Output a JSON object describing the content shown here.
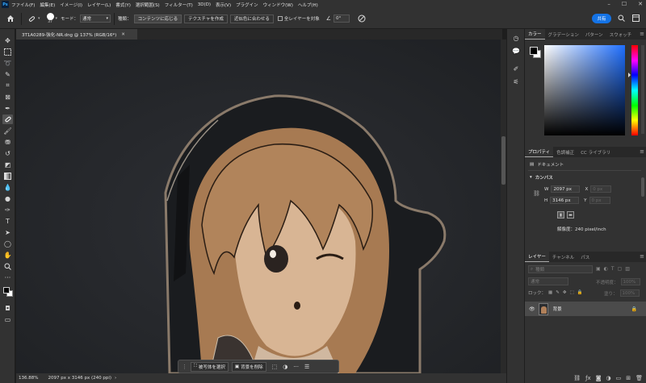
{
  "menu": {
    "logo": "Ps",
    "items": [
      "ファイル(F)",
      "編集(E)",
      "イメージ(I)",
      "レイヤー(L)",
      "書式(Y)",
      "選択範囲(S)",
      "フィルター(T)",
      "3D(D)",
      "表示(V)",
      "プラグイン",
      "ウィンドウ(W)",
      "ヘルプ(H)"
    ]
  },
  "options": {
    "brush_size": "37",
    "mode_label": "モード：",
    "mode_value": "通常",
    "type_label": "種類：",
    "content_aware": "コンテンツに応じる",
    "texture": "テクスチャを作成",
    "proximity": "近似色に合わせる",
    "all_layers": "全レイヤーを対象",
    "angle": "0°",
    "share": "共有"
  },
  "document": {
    "tab_title": "3T1A0289-強化-NR.dng @ 137% (RGB/16*)"
  },
  "taskbar": {
    "select_subject": "被写体を選択",
    "remove_bg": "背景を削除"
  },
  "status": {
    "zoom": "136.88%",
    "size": "2097 px x 3146 px (240 ppi)"
  },
  "color_panel": {
    "tabs": [
      "カラー",
      "グラデーション",
      "パターン",
      "スウォッチ"
    ]
  },
  "properties": {
    "tabs": [
      "プロパティ",
      "色調補正",
      "CC ライブラリ"
    ],
    "doc_label": "ドキュメント",
    "canvas_label": "カンバス",
    "w_label": "W",
    "w_value": "2097 px",
    "x_label": "X",
    "x_value": "0 px",
    "h_label": "H",
    "h_value": "3146 px",
    "y_label": "Y",
    "y_value": "0 px",
    "resolution": "解像度：240 pixel/inch"
  },
  "layers": {
    "tabs": [
      "レイヤー",
      "チャンネル",
      "パス"
    ],
    "search_placeholder": "種類",
    "blend_mode": "通常",
    "opacity_label": "不透明度：",
    "opacity_value": "100%",
    "lock_label": "ロック：",
    "fill_label": "塗り：",
    "fill_value": "100%",
    "layer_name": "背景"
  }
}
